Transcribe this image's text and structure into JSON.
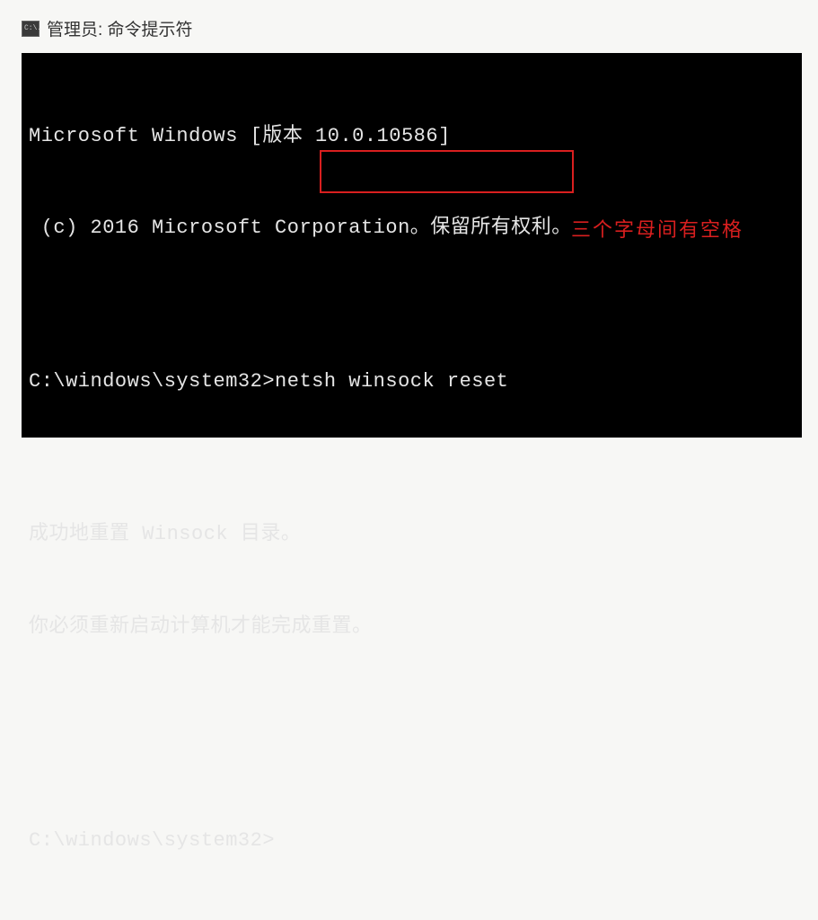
{
  "title": {
    "icon_text": "C:\\.",
    "text": "管理员: 命令提示符"
  },
  "terminal": {
    "lines": {
      "version": "Microsoft Windows [版本 10.0.10586]",
      "copyright": " (c) 2016 Microsoft Corporation。保留所有权利。",
      "blank": "",
      "prompt1_path": "C:\\windows\\system32>",
      "prompt1_cmd": "netsh winsock reset",
      "result1": "成功地重置 Winsock 目录。",
      "result2": "你必须重新启动计算机才能完成重置。",
      "prompt2_path": "C:\\windows\\system32>"
    },
    "annotation": "三个字母间有空格"
  }
}
